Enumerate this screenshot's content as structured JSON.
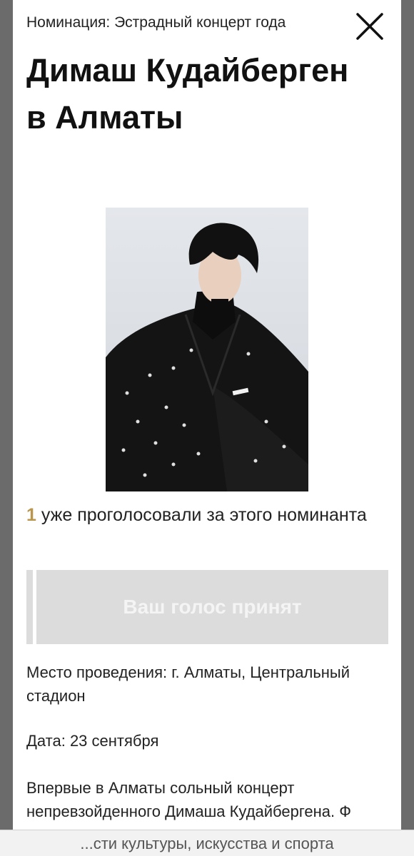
{
  "modal": {
    "nomination": "Номинация: Эстрадный концерт года",
    "title": "Димаш Кудайберген в Алматы",
    "photo_alt": "Димаш Кудайберген",
    "votes": {
      "count": "1",
      "text": " уже проголосовали за этого номинанта"
    },
    "vote_button_label": "Ваш голос принят",
    "venue": "Место проведения: г. Алматы, Центральный стадион",
    "date": "Дата: 23 сентября",
    "description": "Впервые в Алматы сольный концерт непревзойденного Димаша Кудайбергена. Ф"
  },
  "footer": {
    "text": "...сти культуры, искусства и спорта"
  },
  "colors": {
    "accent_gold": "#b8964e",
    "button_disabled": "#dcdcdc",
    "overlay": "#6b6b6b"
  },
  "icons": {
    "close": "close-icon"
  }
}
